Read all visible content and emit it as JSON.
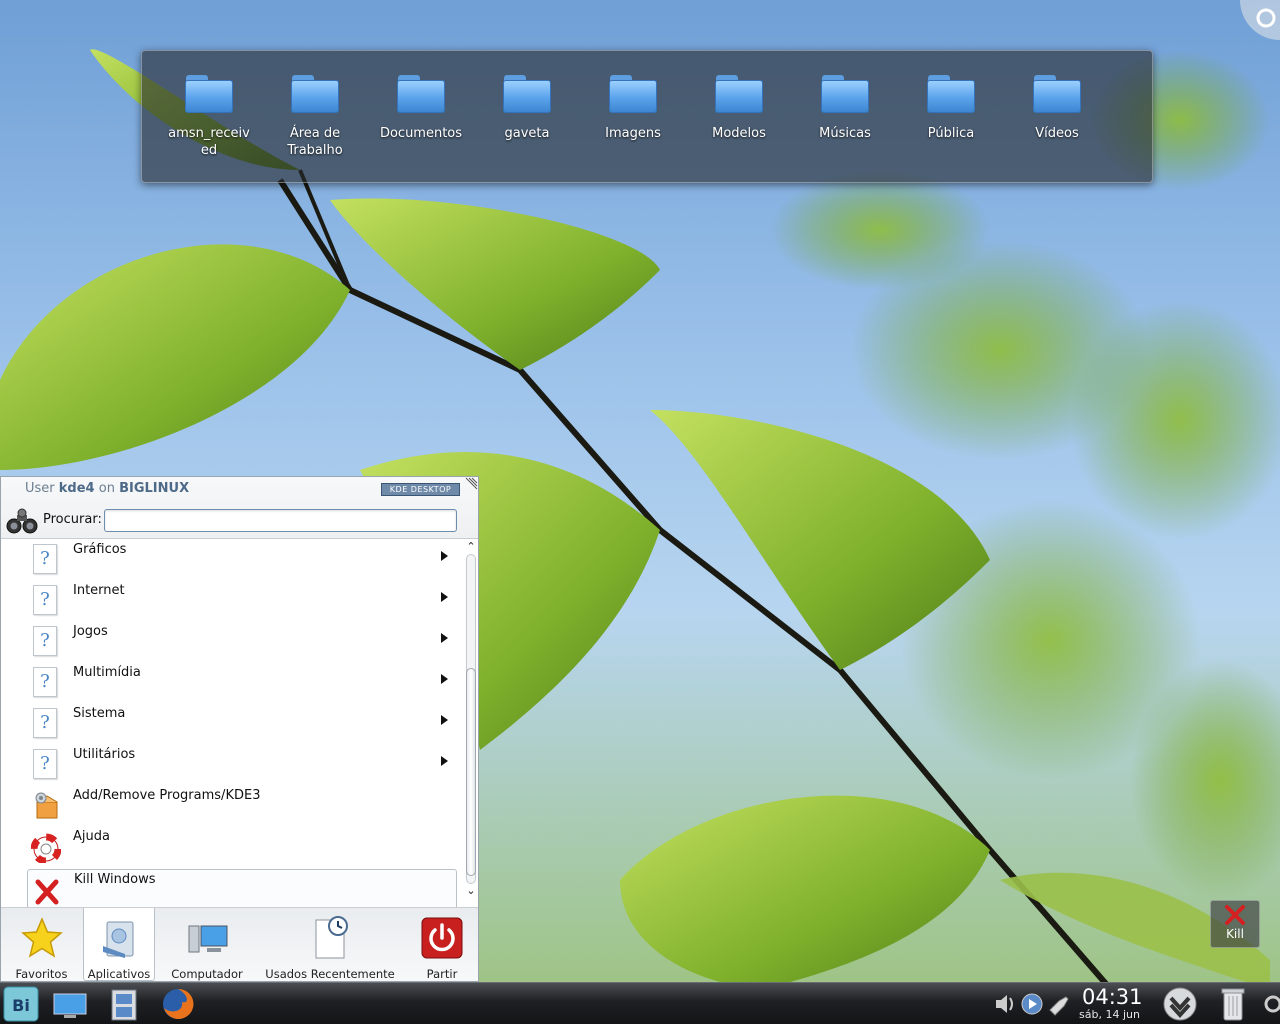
{
  "folderview": {
    "items": [
      {
        "label": "amsn_received"
      },
      {
        "label": "Área de Trabalho"
      },
      {
        "label": "Documentos"
      },
      {
        "label": "gaveta"
      },
      {
        "label": "Imagens"
      },
      {
        "label": "Modelos"
      },
      {
        "label": "Músicas"
      },
      {
        "label": "Pública"
      },
      {
        "label": "Vídeos"
      }
    ]
  },
  "kickoff": {
    "user_prefix": "User",
    "user_name": "kde4",
    "user_on": "on",
    "host": "BIGLINUX",
    "badge": "KDE DESKTOP",
    "search_label": "Procurar:",
    "search_value": "",
    "items": [
      {
        "label": "Gráficos",
        "icon": "unknown-document-icon",
        "submenu": true
      },
      {
        "label": "Internet",
        "icon": "unknown-document-icon",
        "submenu": true
      },
      {
        "label": "Jogos",
        "icon": "unknown-document-icon",
        "submenu": true
      },
      {
        "label": "Multimídia",
        "icon": "unknown-document-icon",
        "submenu": true
      },
      {
        "label": "Sistema",
        "icon": "unknown-document-icon",
        "submenu": true
      },
      {
        "label": "Utilitários",
        "icon": "unknown-document-icon",
        "submenu": true
      },
      {
        "label": "Add/Remove Programs/KDE3",
        "icon": "package-install-icon",
        "submenu": false
      },
      {
        "label": "Ajuda",
        "icon": "lifebuoy-help-icon",
        "submenu": false
      },
      {
        "label": "Kill Windows",
        "icon": "red-x-icon",
        "submenu": false
      }
    ],
    "tabs": [
      {
        "label": "Favoritos",
        "icon": "star-icon"
      },
      {
        "label": "Aplicativos",
        "icon": "applications-icon"
      },
      {
        "label": "Computador",
        "icon": "computer-icon"
      },
      {
        "label": "Usados Recentemente",
        "icon": "recent-documents-icon"
      },
      {
        "label": "Partir",
        "icon": "power-icon"
      }
    ],
    "active_tab": "Aplicativos"
  },
  "widgets": {
    "kill_label": "Kill"
  },
  "taskbar": {
    "clock_time": "04:31",
    "clock_date": "sáb, 14 jun"
  },
  "colors": {
    "panel_dark": "#1e2023",
    "folder_blue": "#5aa2ea",
    "kill_red": "#d42020",
    "power_red": "#c8201e",
    "star_yellow": "#f6d21c"
  }
}
